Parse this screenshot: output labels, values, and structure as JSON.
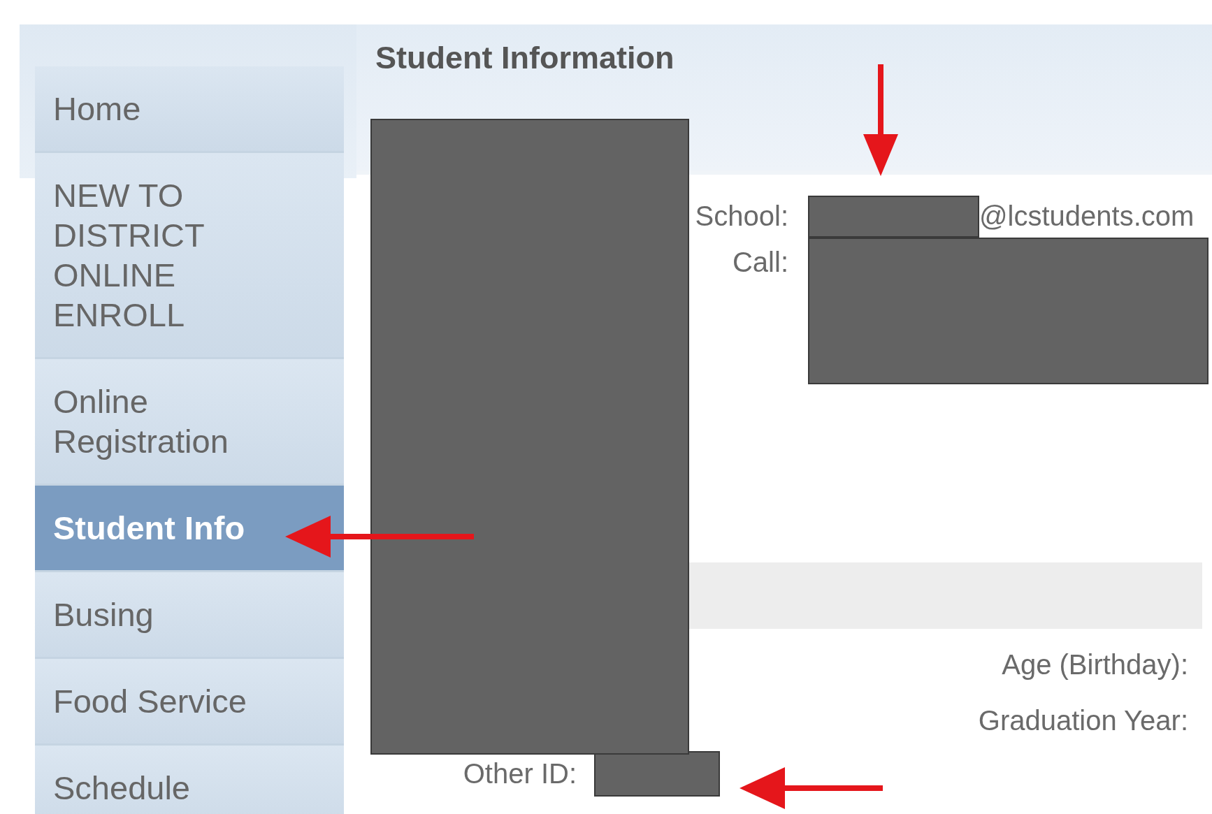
{
  "sidebar": {
    "items": [
      {
        "label": "Home",
        "selected": false
      },
      {
        "label": "NEW TO DISTRICT ONLINE ENROLL",
        "selected": false
      },
      {
        "label": "Online Registration",
        "selected": false
      },
      {
        "label": "Student Info",
        "selected": true
      },
      {
        "label": "Busing",
        "selected": false
      },
      {
        "label": "Food Service",
        "selected": false
      },
      {
        "label": "Schedule",
        "selected": false
      }
    ]
  },
  "main": {
    "title": "Student Information",
    "contact": [
      {
        "label": "School:",
        "suffix": "@lcstudents.com"
      },
      {
        "label": "Call:"
      }
    ],
    "details": [
      {
        "label": "Age (Birthday):"
      },
      {
        "label": "Graduation Year:"
      }
    ],
    "other_id": {
      "label": "Other ID:"
    }
  }
}
